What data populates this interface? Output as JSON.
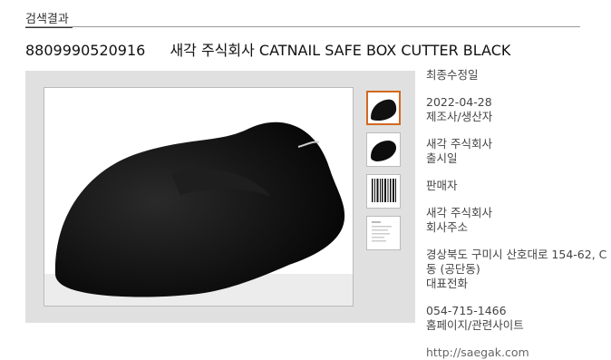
{
  "section": {
    "title": "검색결과"
  },
  "product": {
    "code": "8809990520916",
    "name": "새각 주식회사 CATNAIL SAFE BOX CUTTER BLACK"
  },
  "info": {
    "modified_label": "최종수정일",
    "modified_value": "2022-04-28",
    "maker_label": "제조사/생산자",
    "maker_value": "새각 주식회사",
    "release_label": "출시일",
    "seller_label": "판매자",
    "seller_value": "새각 주식회사",
    "address_label": "회사주소",
    "address_value": "경상북도 구미시 산호대로 154-62, C동 (공단동)",
    "phone_label": "대표전화",
    "phone_value": "054-715-1466",
    "website_label": "홈페이지/관련사이트",
    "website_value": "http://saegak.com"
  },
  "gallery": {
    "thumbnails": [
      "product-front",
      "product-angle",
      "barcode",
      "label-document"
    ],
    "selected_thumbnail": 1,
    "accent": "#d2691e"
  }
}
